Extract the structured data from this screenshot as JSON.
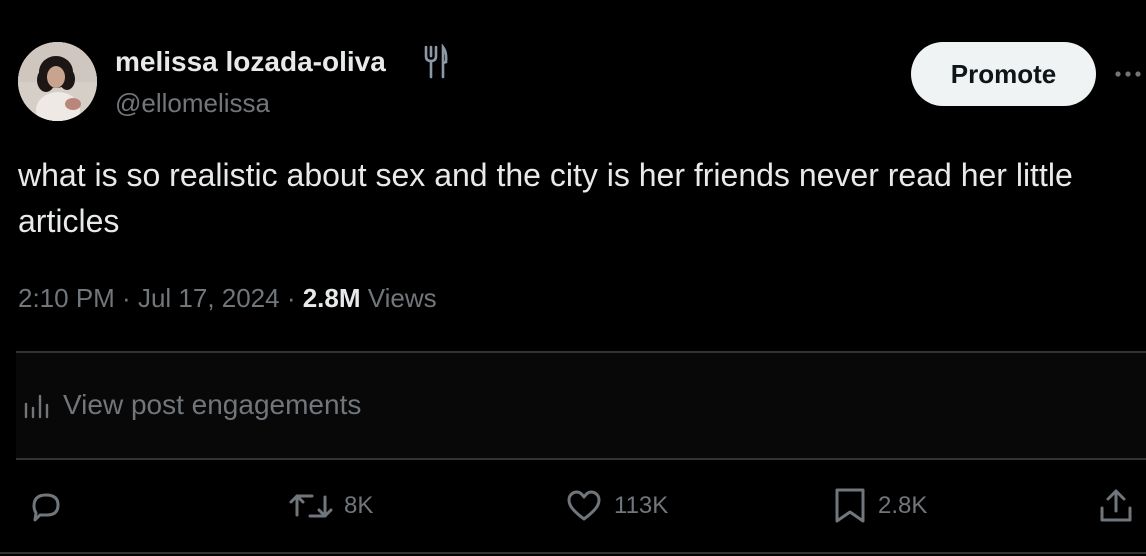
{
  "author": {
    "display_name": "melissa lozada-oliva",
    "handle": "@ellomelissa",
    "badge_icon": "fork-and-knife-icon",
    "avatar_icon": "profile-photo"
  },
  "header": {
    "promote_label": "Promote",
    "more_icon": "more-horizontal-icon"
  },
  "tweet": {
    "text": "what is so realistic about sex and the city is her friends never read her little articles"
  },
  "meta": {
    "time": "2:10 PM",
    "separator": " · ",
    "date": "Jul 17, 2024",
    "views_count": "2.8M",
    "views_label": "Views"
  },
  "engagements": {
    "label": "View post engagements",
    "icon": "bar-chart-icon"
  },
  "actions": {
    "reply": {
      "icon": "reply-icon",
      "count": ""
    },
    "retweet": {
      "icon": "retweet-icon",
      "count": "8K"
    },
    "like": {
      "icon": "heart-icon",
      "count": "113K"
    },
    "bookmark": {
      "icon": "bookmark-icon",
      "count": "2.8K"
    },
    "share": {
      "icon": "share-icon"
    }
  },
  "colors": {
    "background": "#000000",
    "text_primary": "#e7e9ea",
    "text_secondary": "#71767b",
    "border": "#2f3336",
    "button_bg": "#eff3f4"
  }
}
